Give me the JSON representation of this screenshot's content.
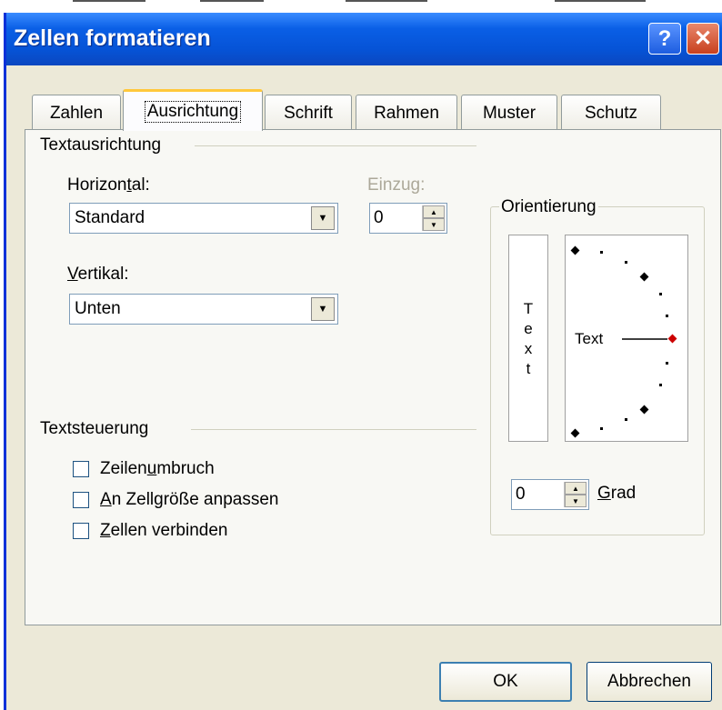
{
  "window": {
    "title": "Zellen formatieren"
  },
  "tabs": [
    {
      "label": "Zahlen"
    },
    {
      "label": "Ausrichtung"
    },
    {
      "label": "Schrift"
    },
    {
      "label": "Rahmen"
    },
    {
      "label": "Muster"
    },
    {
      "label": "Schutz"
    }
  ],
  "active_tab": "Ausrichtung",
  "textausrichtung": {
    "group_label": "Textausrichtung",
    "horizontal": {
      "label_pre": "Horizon",
      "label_ul": "t",
      "label_post": "al:",
      "value": "Standard"
    },
    "einzug": {
      "label": "Einzug:",
      "value": "0"
    },
    "vertikal": {
      "label_ul": "V",
      "label_post": "ertikal:",
      "value": "Unten"
    }
  },
  "orientierung": {
    "group_label": "Orientierung",
    "vertical_text": [
      "T",
      "e",
      "x",
      "t"
    ],
    "dial_text": "Text",
    "degrees_value": "0",
    "grad_label_ul": "G",
    "grad_label_post": "rad"
  },
  "textsteuerung": {
    "group_label": "Textsteuerung",
    "options": [
      {
        "pre": "Zeilen",
        "ul": "u",
        "post": "mbruch",
        "checked": false
      },
      {
        "pre": "",
        "ul": "A",
        "post": "n Zellgröße anpassen",
        "checked": false
      },
      {
        "pre": "",
        "ul": "Z",
        "post": "ellen verbinden",
        "checked": false
      }
    ]
  },
  "buttons": {
    "ok": "OK",
    "cancel": "Abbrechen"
  },
  "icons": {
    "help": "?",
    "close": "✕",
    "dropdown": "▼",
    "spin_up": "▲",
    "spin_down": "▼"
  },
  "colors": {
    "titlebar": "#0653d6",
    "dial_marker_active": "#cc0000"
  }
}
